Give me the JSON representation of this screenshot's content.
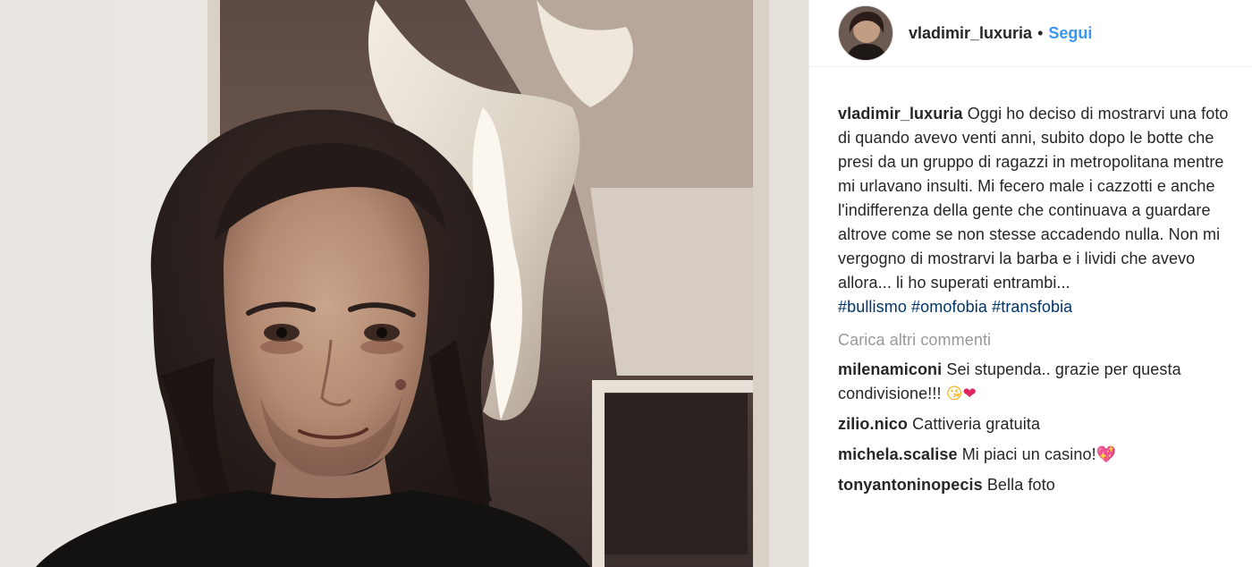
{
  "post": {
    "author": "vladimir_luxuria",
    "separator": "•",
    "follow_label": "Segui",
    "caption_text": "Oggi ho deciso di mostrarvi una foto di quando avevo venti anni, subito dopo le botte che presi da un gruppo di ragazzi in metropolitana mentre mi urlavano insulti. Mi fecero male i cazzotti e anche l'indifferenza della gente che continuava a guardare altrove come se non stesse accadendo nulla. Non mi vergogno di mostrarvi la barba e i lividi che avevo allora... li ho superati entrambi...",
    "hashtags": [
      "#bullismo",
      "#omofobia",
      "#transfobia"
    ],
    "load_more_label": "Carica altri commenti"
  },
  "comments": [
    {
      "user": "milenamiconi",
      "text": "Sei stupenda.. grazie per questa condivisione!!!",
      "emoji": [
        "😘",
        "❤"
      ]
    },
    {
      "user": "zilio.nico",
      "text": "Cattiveria gratuita",
      "emoji": []
    },
    {
      "user": "michela.scalise",
      "text": "Mi piaci un casino!",
      "emoji": [
        "💖"
      ]
    },
    {
      "user": "tonyantoninopecis",
      "text": "Bella foto",
      "emoji": []
    }
  ],
  "icons": {
    "avatar": "profile-avatar",
    "photo": "post-photo"
  },
  "colors": {
    "link_blue": "#3897f0",
    "hashtag_blue": "#003569",
    "muted_gray": "#999999",
    "text": "#262626"
  }
}
